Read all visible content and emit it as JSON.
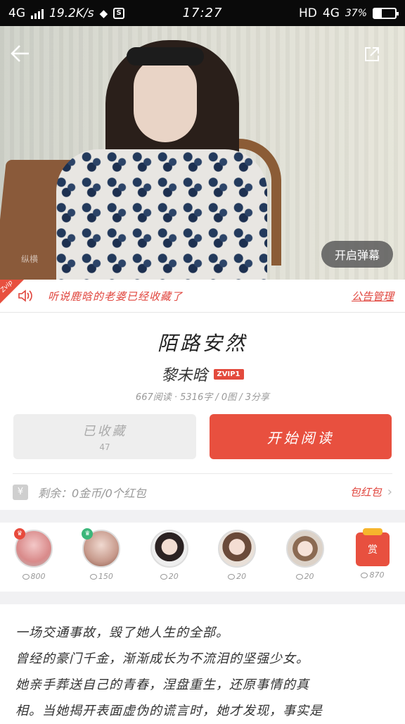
{
  "status_bar": {
    "network_left": "4G",
    "speed": "19.2K/s",
    "time": "17:27",
    "hd": "HD",
    "network_right": "4G",
    "battery": "37%",
    "battery_level": 0.37
  },
  "hero": {
    "watermark": "纵横",
    "danmu_button": "开启弹幕"
  },
  "notice": {
    "corner_badge": "Zvip",
    "text": "听说鹿晗的老婆已经收藏了",
    "link": "公告管理"
  },
  "book": {
    "title": "陌路安然",
    "author": "黎未晗",
    "vip_badge": "ZVIP1",
    "stats": "667阅读 · 5316字 / 0图 / 3分享"
  },
  "actions": {
    "collected_label": "已收藏",
    "collected_count": "47",
    "read_label": "开始阅读"
  },
  "gift": {
    "text": "剩余：0金币/0个红包",
    "link": "包红包"
  },
  "fans": [
    {
      "count": "800",
      "crown": "red"
    },
    {
      "count": "150",
      "crown": "green"
    },
    {
      "count": "20",
      "crown": ""
    },
    {
      "count": "20",
      "crown": ""
    },
    {
      "count": "20",
      "crown": ""
    }
  ],
  "reward": {
    "label": "赏",
    "count": "870"
  },
  "description": {
    "line1": "一场交通事故，毁了她人生的全部。",
    "line2": "曾经的豪门千金，渐渐成长为不流泪的坚强少女。",
    "line3": "她亲手葬送自己的青春，涅盘重生，还原事情的真",
    "line4": "相。当她揭开表面虚伪的谎言时，她才发现，事实是"
  },
  "colors": {
    "accent": "#e8503f",
    "link": "#e0433b"
  }
}
